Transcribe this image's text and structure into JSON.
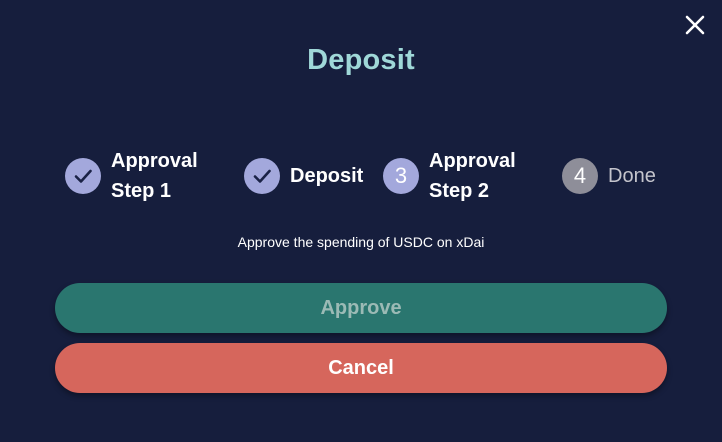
{
  "dialog": {
    "title": "Deposit",
    "close_icon": "close-icon",
    "message": "Approve the spending of USDC on xDai"
  },
  "steps": [
    {
      "label_line1": "Approval",
      "label_line2": "Step 1",
      "state": "done",
      "icon": "check-icon"
    },
    {
      "label_line1": "Deposit",
      "label_line2": "",
      "state": "done",
      "icon": "check-icon"
    },
    {
      "number": "3",
      "label_line1": "Approval",
      "label_line2": "Step 2",
      "state": "active"
    },
    {
      "number": "4",
      "label_line1": "Done",
      "label_line2": "",
      "state": "pending"
    }
  ],
  "buttons": {
    "approve_label": "Approve",
    "cancel_label": "Cancel"
  },
  "colors": {
    "background": "#161e3d",
    "title": "#9fd8d8",
    "step_circle": "#a3a8dc",
    "step_pending": "#8e8e99",
    "approve_button": "#2a766f",
    "cancel_button": "#d6665c"
  }
}
